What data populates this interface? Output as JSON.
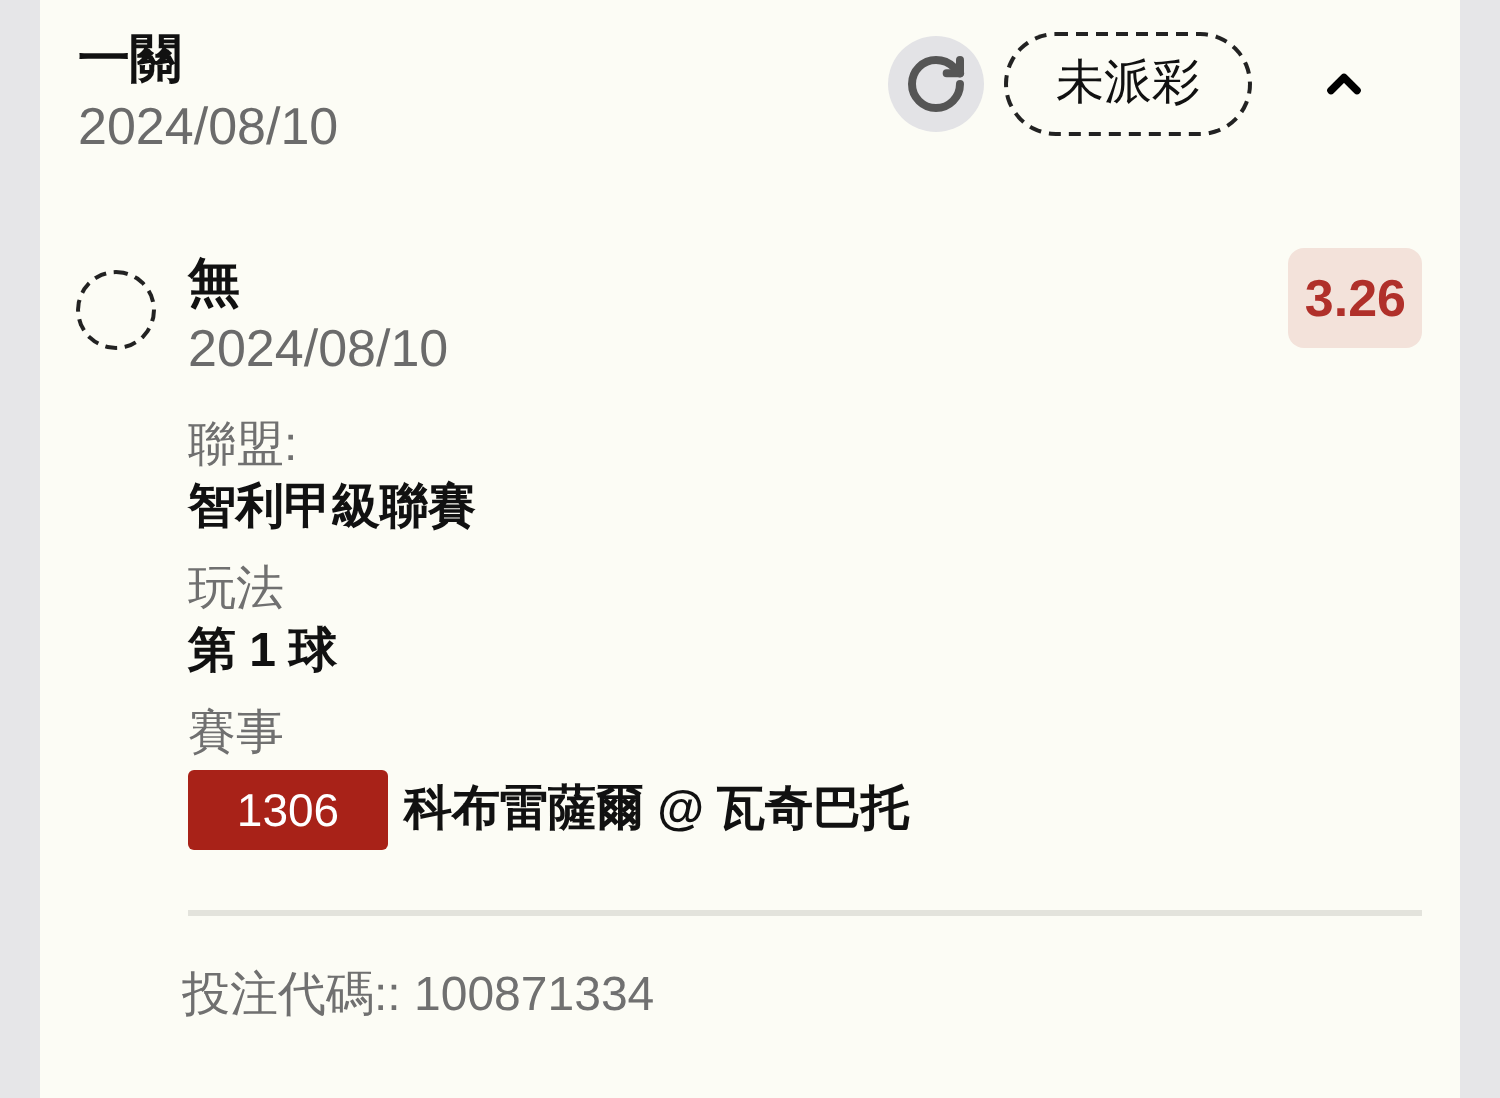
{
  "bet": {
    "title": "一關",
    "date": "2024/08/10",
    "status": "未派彩",
    "expanded": true
  },
  "leg": {
    "selection": "無",
    "date": "2024/08/10",
    "odds": "3.26",
    "fields": [
      {
        "label": "聯盟:",
        "value": "智利甲級聯賽"
      },
      {
        "label": "玩法",
        "value": "第 1 球"
      }
    ],
    "event": {
      "label": "賽事",
      "code": "1306",
      "teams": "科布雷薩爾 @ 瓦奇巴托"
    }
  },
  "bet_code": "投注代碼:: 100871334"
}
